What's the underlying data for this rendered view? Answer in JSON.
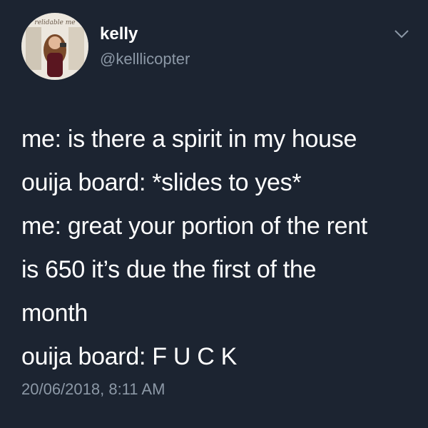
{
  "user": {
    "avatar_text": "relidable me",
    "name": "kelly",
    "handle": "@kelllicopter"
  },
  "icons": {
    "menu": "chevron-down-icon"
  },
  "tweet": {
    "lines": [
      "me: is there a spirit in my house",
      "ouija board: *slides to yes*",
      "me: great your portion of the rent",
      "is 650 it’s due the first of the",
      "month",
      "ouija board: F U C K"
    ],
    "timestamp": "20/06/2018, 8:11 AM"
  },
  "colors": {
    "background": "#1c2431",
    "text": "#ffffff",
    "secondary": "#8c98a6"
  }
}
